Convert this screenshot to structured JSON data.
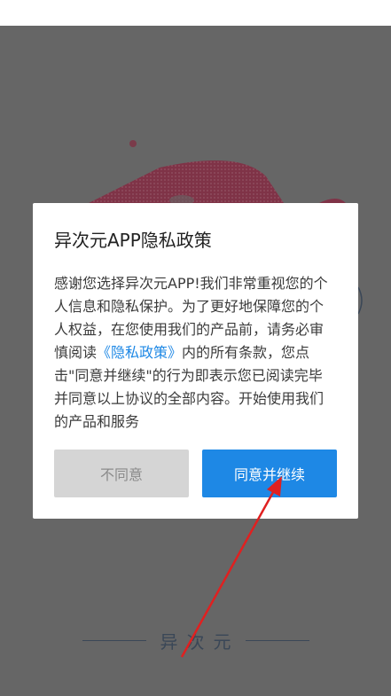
{
  "dialog": {
    "title": "异次元APP隐私政策",
    "body_before_link": "感谢您选择异次元APP!我们非常重视您的个人信息和隐私保护。为了更好地保障您的个人权益，在您使用我们的产品前，请务必审慎阅读",
    "policy_link": "《隐私政策》",
    "body_after_link": "内的所有条款，您点击\"同意并继续\"的行为即表示您已阅读完毕并同意以上协议的全部内容。开始使用我们的产品和服务",
    "disagree_label": "不同意",
    "agree_label": "同意并继续"
  },
  "footer": {
    "brand": "异次元"
  },
  "colors": {
    "accent": "#1e88e5",
    "overlay": "#666666",
    "annotation": "#e02020"
  }
}
